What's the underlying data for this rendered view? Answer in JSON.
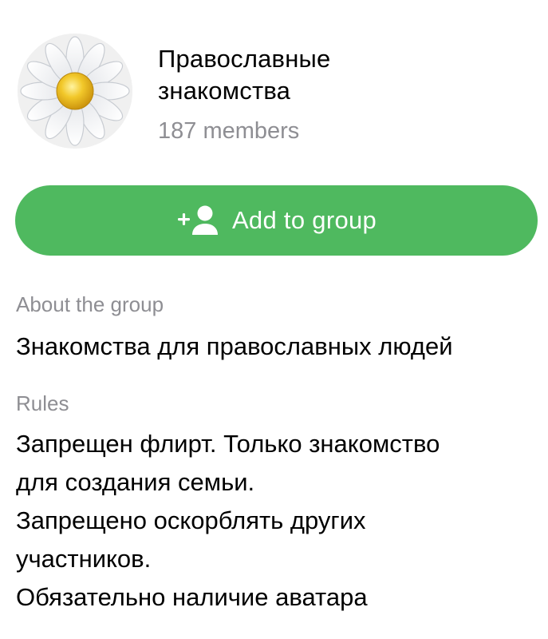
{
  "group": {
    "name_line1": "Православные",
    "name_line2": "знакомства",
    "members": "187 members",
    "avatar_icon": "daisy-flower-icon"
  },
  "actions": {
    "add_to_group_label": "Add to group",
    "add_icon": "add-user-icon",
    "button_color": "#4fb95f"
  },
  "about": {
    "label": "About the group",
    "text": "Знакомства для православных людей"
  },
  "rules": {
    "label": "Rules",
    "lines": [
      "Запрещен флирт. Только знакомство",
      "для создания семьи.",
      "Запрещено оскорблять  других",
      "участников.",
      "Обязательно наличие аватара"
    ]
  },
  "colors": {
    "secondary_text": "#8e8e93",
    "primary_text": "#000000",
    "avatar_background": "#f0f0f0",
    "flower_center": "#e8b818"
  }
}
